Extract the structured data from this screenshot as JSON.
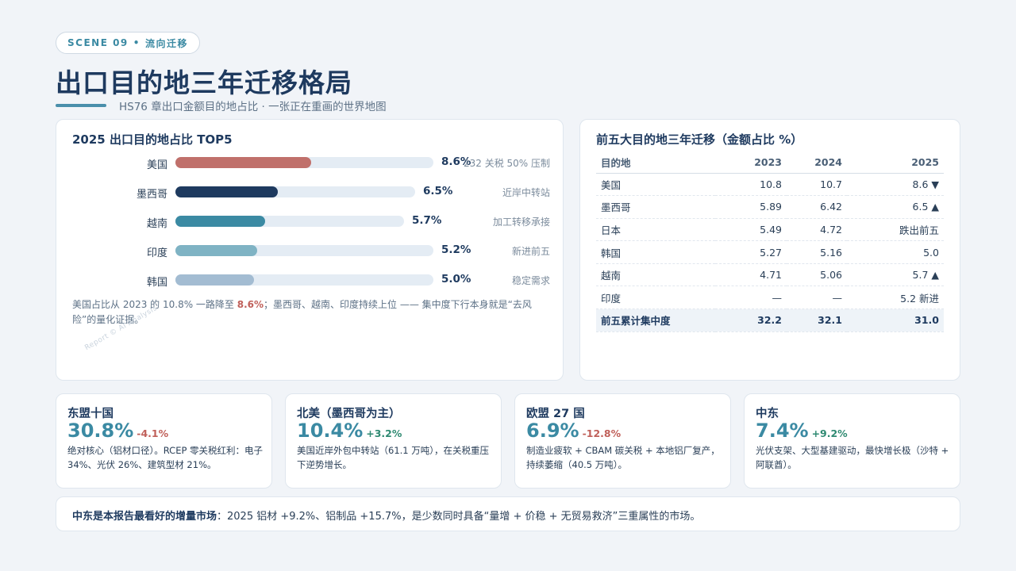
{
  "header": {
    "scene_tag": "SCENE 09",
    "scene_dot": "•",
    "scene_name": "流向迁移",
    "title": "出口目的地三年迁移格局",
    "subtitle": "HS76 章出口金额目的地占比 · 一张正在重画的世界地图"
  },
  "top5": {
    "title": "2025 出口目的地占比 TOP5",
    "bars": [
      {
        "name": "美国",
        "value": 8.6,
        "label": "8.6%",
        "note": "232 关税 50% 压制",
        "color": "#c0706b",
        "track_value": 11.6
      },
      {
        "name": "墨西哥",
        "value": 6.5,
        "label": "6.5%",
        "note": "近岸中转站",
        "color": "#1e3a5f",
        "track_value": 10.8
      },
      {
        "name": "越南",
        "value": 5.7,
        "label": "5.7%",
        "note": "加工转移承接",
        "color": "#3b8aa3",
        "track_value": 10.3
      },
      {
        "name": "印度",
        "value": 5.2,
        "label": "5.2%",
        "note": "新进前五",
        "color": "#7fb3c4",
        "track_value": 11.6
      },
      {
        "name": "韩国",
        "value": 5.0,
        "label": "5.0%",
        "note": "稳定需求",
        "color": "#a3bcd2",
        "track_value": 11.6
      }
    ],
    "note_pre": "美国占比从 2023 的 10.8% 一路降至 ",
    "note_hl": "8.6%",
    "note_post": "；墨西哥、越南、印度持续上位 —— 集中度下行本身就是“去风险”的量化证据。",
    "watermark": "Report © AI Analysis"
  },
  "migration": {
    "title": "前五大目的地三年迁移（金额占比 %）",
    "headers": [
      "目的地",
      "2023",
      "2024",
      "2025"
    ],
    "rows": [
      {
        "name": "美国",
        "y2023": "10.8",
        "y2024": "10.7",
        "y2025": "8.6 ▼",
        "trend": "down"
      },
      {
        "name": "墨西哥",
        "y2023": "5.89",
        "y2024": "6.42",
        "y2025": "6.5 ▲",
        "trend": "up"
      },
      {
        "name": "日本",
        "y2023": "5.49",
        "y2024": "4.72",
        "y2025": "跌出前五",
        "trend": "muted"
      },
      {
        "name": "韩国",
        "y2023": "5.27",
        "y2024": "5.16",
        "y2025": "5.0",
        "trend": "flat"
      },
      {
        "name": "越南",
        "y2023": "4.71",
        "y2024": "5.06",
        "y2025": "5.7 ▲",
        "trend": "up"
      },
      {
        "name": "印度",
        "y2023": "—",
        "y2024": "—",
        "y2025": "5.2 新进",
        "trend": "up"
      }
    ],
    "total": {
      "name": "前五累计集中度",
      "y2023": "32.2",
      "y2024": "32.1",
      "y2025": "31.0"
    }
  },
  "regions": [
    {
      "name": "东盟十国",
      "share": "30.8%",
      "delta": "-4.1%",
      "trend": "down",
      "desc": "绝对核心（铝材口径）。RCEP 零关税红利：电子 34%、光伏 26%、建筑型材 21%。"
    },
    {
      "name": "北美（墨西哥为主）",
      "share": "10.4%",
      "delta": "+3.2%",
      "trend": "up",
      "desc": "美国近岸外包中转站（61.1 万吨），在关税重压下逆势增长。"
    },
    {
      "name": "欧盟 27 国",
      "share": "6.9%",
      "delta": "-12.8%",
      "trend": "down",
      "desc": "制造业疲软 + CBAM 碳关税 + 本地铝厂复产，持续萎缩（40.5 万吨）。"
    },
    {
      "name": "中东",
      "share": "7.4%",
      "delta": "+9.2%",
      "trend": "up",
      "desc": "光伏支架、大型基建驱动，最快增长极（沙特 + 阿联酋）。"
    }
  ],
  "bottom": {
    "strong": "中东是本报告最看好的增量市场",
    "text": "：2025 铝材 +9.2%、铝制品 +15.7%，是少数同时具备“量增 + 价稳 + 无贸易救济”三重属性的市场。"
  },
  "colors": {
    "down": "#c0605a",
    "up": "#2f8a72",
    "accent": "#3b8aa3",
    "navy": "#1e3a5f"
  }
}
